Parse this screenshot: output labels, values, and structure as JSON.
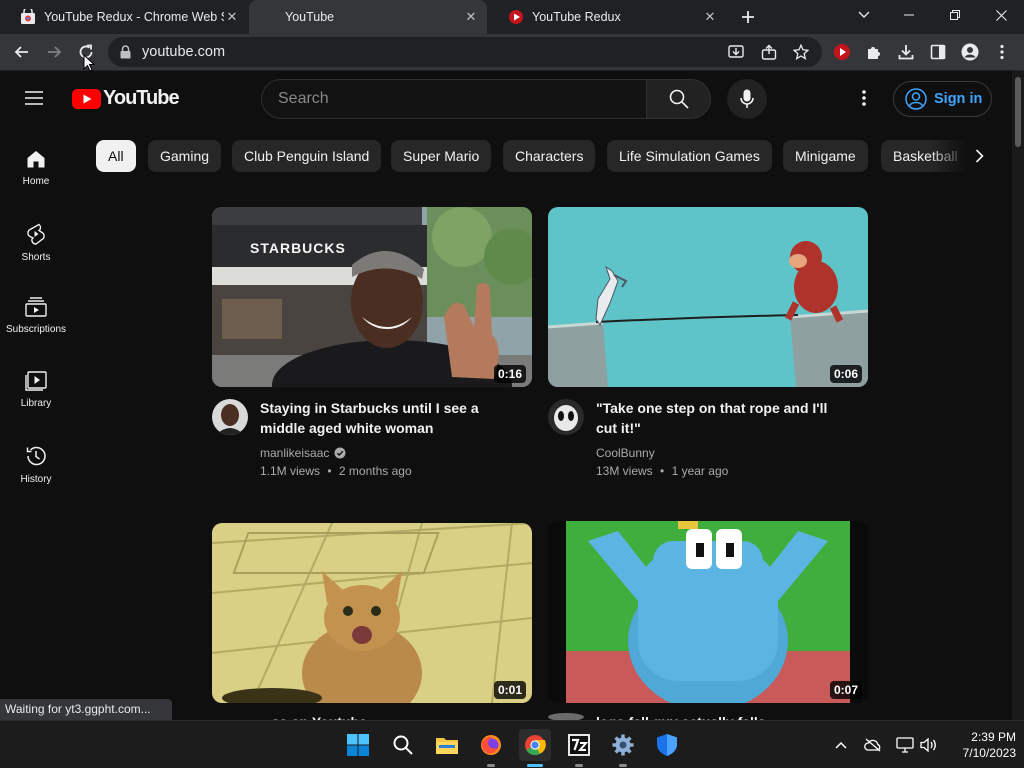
{
  "browser": {
    "tabs": [
      {
        "title": "YouTube Redux - Chrome Web Store",
        "active": false
      },
      {
        "title": "YouTube",
        "active": true
      },
      {
        "title": "YouTube Redux",
        "active": false
      }
    ],
    "url": "youtube.com",
    "status_text": "Waiting for yt3.ggpht.com..."
  },
  "youtube": {
    "logo_text": "YouTube",
    "search_placeholder": "Search",
    "sign_in_label": "Sign in",
    "sidebar": [
      {
        "label": "Home",
        "icon": "home-icon"
      },
      {
        "label": "Shorts",
        "icon": "shorts-icon"
      },
      {
        "label": "Subscriptions",
        "icon": "subscriptions-icon"
      },
      {
        "label": "Library",
        "icon": "library-icon"
      },
      {
        "label": "History",
        "icon": "history-icon"
      }
    ],
    "chips": [
      "All",
      "Gaming",
      "Club Penguin Island",
      "Super Mario",
      "Characters",
      "Life Simulation Games",
      "Minigame",
      "Basketball"
    ],
    "videos": [
      {
        "title": "Staying in Starbucks until I see a middle aged white woman",
        "channel": "manlikeisaac",
        "verified": true,
        "views": "1.1M views",
        "age": "2 months ago",
        "duration": "0:16",
        "thumb_text": "STARBUCKS"
      },
      {
        "title": "\"Take one step on that rope and I'll cut it!\"",
        "channel": "CoolBunny",
        "verified": false,
        "views": "13M views",
        "age": "1 year ago",
        "duration": "0:06"
      },
      {
        "title": "...ss on Youtube",
        "duration": "0:01"
      },
      {
        "title": "lego fall guy actually falls",
        "duration": "0:07"
      }
    ],
    "meta_separator": "•"
  },
  "taskbar": {
    "clock_time": "2:39 PM",
    "clock_date": "7/10/2023"
  },
  "colors": {
    "yt_red": "#ff0000",
    "link_blue": "#3ea6ff",
    "accent_taskbar": "#4cc2ff"
  }
}
